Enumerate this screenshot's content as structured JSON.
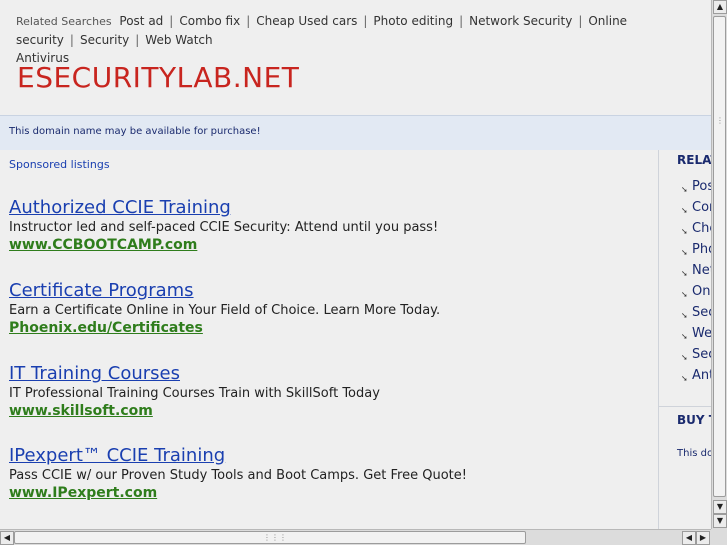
{
  "related": {
    "label": "Related Searches",
    "items": [
      "Post ad",
      "Combo fix",
      "Cheap Used cars",
      "Photo editing",
      "Network Security",
      "Online security",
      "Security",
      "Web Watch",
      "Antivirus"
    ]
  },
  "site_title": "ESECURITYLAB.NET",
  "notice": "This domain name may be available for purchase!",
  "main": {
    "sponsored_label": "Sponsored listings",
    "ads": [
      {
        "title": "Authorized CCIE Training",
        "desc": "Instructor led and self-paced CCIE Security: Attend until you pass!",
        "url": "www.CCBOOTCAMP.com"
      },
      {
        "title": "Certificate Programs",
        "desc": "Earn a Certificate Online in Your Field of Choice. Learn More Today.",
        "url": "Phoenix.edu/Certificates"
      },
      {
        "title": "IT Training Courses",
        "desc": "IT Professional Training Courses Train with SkillSoft Today",
        "url": "www.skillsoft.com"
      },
      {
        "title": "IPexpert™ CCIE Training",
        "desc": "Pass CCIE w/ our Proven Study Tools and Boot Camps. Get Free Quote!",
        "url": "www.IPexpert.com"
      }
    ]
  },
  "right": {
    "heading": "RELATED",
    "items": [
      "Post ad",
      "Combo fix",
      "Cheap Used cars",
      "Photo editing",
      "Network Security",
      "Online security",
      "Security",
      "Web Watch",
      "Security",
      "Antivirus"
    ],
    "buy_heading": "BUY THIS",
    "buy_text": "This domain"
  },
  "scroll": {
    "up_icon": "▲",
    "down_icon": "▼",
    "left_icon": "◀",
    "right_icon": "▶"
  }
}
